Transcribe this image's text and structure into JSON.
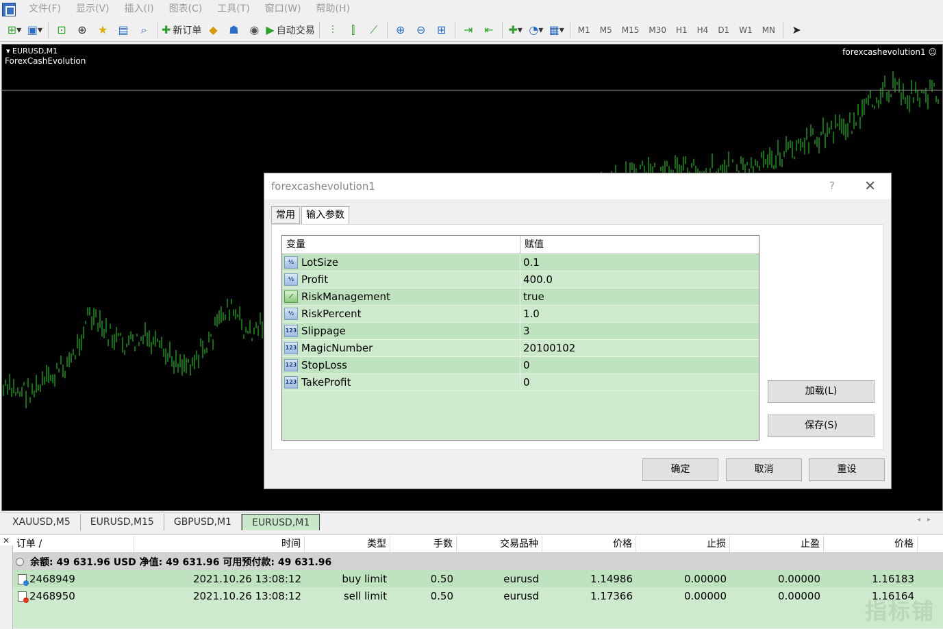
{
  "menu": [
    "文件(F)",
    "显示(V)",
    "插入(I)",
    "图表(C)",
    "工具(T)",
    "窗口(W)",
    "帮助(H)"
  ],
  "toolbar": {
    "new_order": "新订单",
    "auto_trade": "自动交易",
    "timeframes": [
      "M1",
      "M5",
      "M15",
      "M30",
      "H1",
      "H4",
      "D1",
      "W1",
      "MN"
    ]
  },
  "chart": {
    "symbol": "EURUSD,M1",
    "ea_name": "ForexCashEvolution",
    "ea_label_right": "forexcashevolution1 ☺"
  },
  "chart_tabs": [
    "XAUUSD,M5",
    "EURUSD,M15",
    "GBPUSD,M1",
    "EURUSD,M1"
  ],
  "active_chart_tab": "EURUSD,M1",
  "dialog": {
    "title": "forexcashevolution1",
    "help": "?",
    "close": "✕",
    "tabs": [
      "常用",
      "输入参数"
    ],
    "grid_header": {
      "variable": "变量",
      "value": "赋值"
    },
    "params": [
      {
        "type": "½",
        "name": "LotSize",
        "value": "0.1"
      },
      {
        "type": "½",
        "name": "Profit",
        "value": "400.0"
      },
      {
        "type": "bool",
        "name": "RiskManagement",
        "value": "true"
      },
      {
        "type": "½",
        "name": "RiskPercent",
        "value": "1.0"
      },
      {
        "type": "123",
        "name": "Slippage",
        "value": "3"
      },
      {
        "type": "123",
        "name": "MagicNumber",
        "value": "20100102"
      },
      {
        "type": "123",
        "name": "StopLoss",
        "value": "0"
      },
      {
        "type": "123",
        "name": "TakeProfit",
        "value": "0"
      }
    ],
    "load_button": "加载(L)",
    "save_button": "保存(S)",
    "ok_button": "确定",
    "cancel_button": "取消",
    "reset_button": "重设"
  },
  "terminal": {
    "close": "✕",
    "columns": [
      "订单 /",
      "时间",
      "类型",
      "手数",
      "交易品种",
      "价格",
      "止损",
      "止盈",
      "价格"
    ],
    "balance_text": "余额: 49 631.96 USD  净值: 49 631.96  可用预付款: 49 631.96",
    "orders": [
      {
        "ticket": "2468949",
        "time": "2021.10.26 13:08:12",
        "type": "buy limit",
        "lots": "0.50",
        "symbol": "eurusd",
        "price": "1.14986",
        "sl": "0.00000",
        "tp": "0.00000",
        "cur_price": "1.16183",
        "dot": "#2a7fd4"
      },
      {
        "ticket": "2468950",
        "time": "2021.10.26 13:08:12",
        "type": "sell limit",
        "lots": "0.50",
        "symbol": "eurusd",
        "price": "1.17366",
        "sl": "0.00000",
        "tp": "0.00000",
        "cur_price": "1.16164",
        "dot": "#e0341e"
      }
    ]
  },
  "watermark": "指标铺"
}
